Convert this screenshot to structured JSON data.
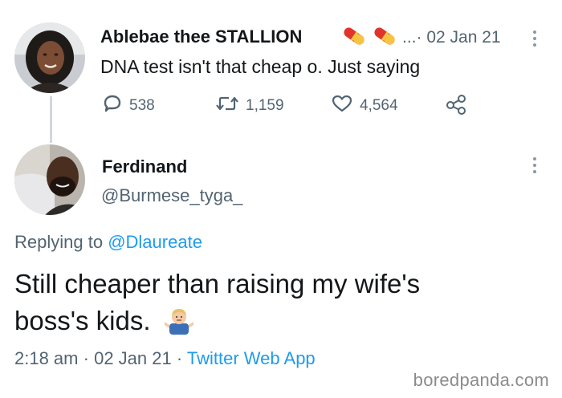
{
  "tweet1": {
    "display_name": "Ablebae thee STALLION",
    "emoji": [
      "pill-icon",
      "pill-icon"
    ],
    "meta": "...· 02 Jan 21",
    "text": "DNA test isn't that cheap o. Just saying",
    "actions": {
      "replies": "538",
      "retweets": "1,159",
      "likes": "4,564"
    }
  },
  "tweet2": {
    "display_name": "Ferdinand",
    "handle": "@Burmese_tyga_",
    "replying_label": "Replying to",
    "replying_handle": "@Dlaureate",
    "text": "Still cheaper than raising my wife's boss's kids.",
    "emoji": "man-shrugging-icon",
    "time": "2:18 am",
    "date": "02 Jan 21",
    "source": "Twitter Web App",
    "separator": "·"
  },
  "watermark": "boredpanda.com",
  "colors": {
    "link": "#1d9bf0",
    "secondary_text": "#536471",
    "thread_line": "#cfd9de"
  }
}
